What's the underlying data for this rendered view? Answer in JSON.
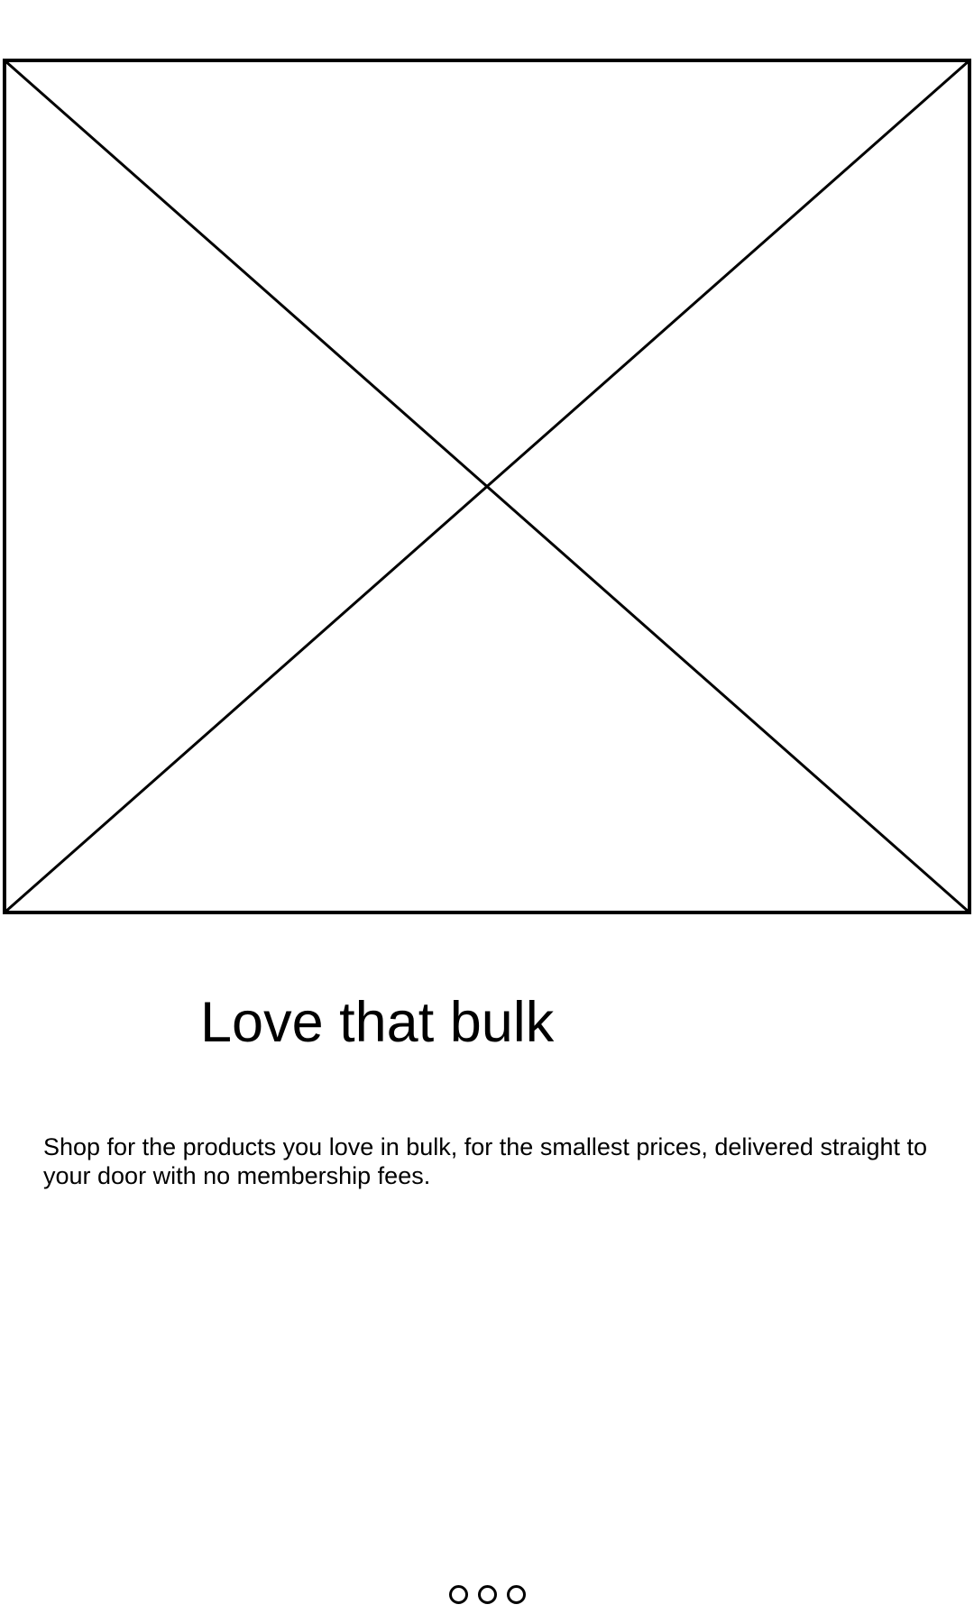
{
  "onboarding": {
    "image_placeholder": "image-placeholder",
    "title": "Love that bulk",
    "description": "Shop for the products you love in bulk, for the smallest prices, delivered straight to your door with no membership fees.",
    "pager": {
      "total_pages": 3,
      "current_page": null
    }
  }
}
